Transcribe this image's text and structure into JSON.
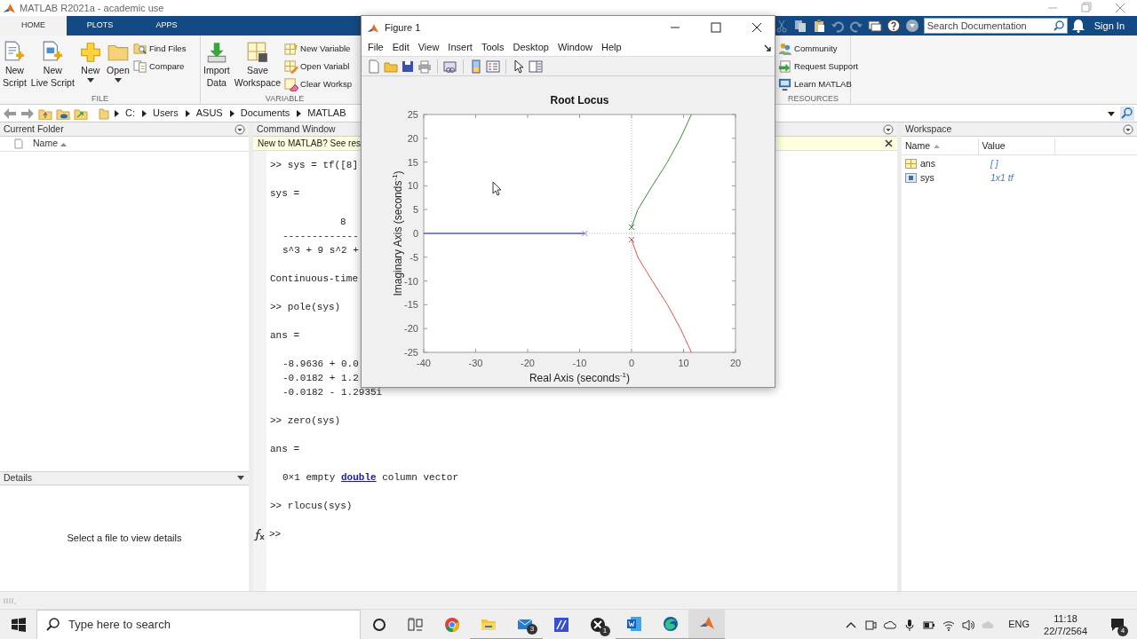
{
  "window": {
    "title": "MATLAB R2021a - academic use"
  },
  "ribbon_tabs": [
    {
      "label": "HOME",
      "selected": true
    },
    {
      "label": "PLOTS",
      "selected": false
    },
    {
      "label": "APPS",
      "selected": false
    }
  ],
  "doc_search": {
    "placeholder": "Search Documentation"
  },
  "sign_in": "Sign In",
  "toolstrip": [
    {
      "title": "FILE",
      "buttons": [
        {
          "label": "New Script",
          "kind": "large"
        },
        {
          "label": "New Live Script",
          "kind": "large"
        },
        {
          "label": "New",
          "kind": "split"
        },
        {
          "label": "Open",
          "kind": "split"
        },
        {
          "label": "Find Files",
          "kind": "small"
        },
        {
          "label": "Compare",
          "kind": "small"
        }
      ]
    },
    {
      "title": "VARIABLE",
      "buttons": [
        {
          "label": "Import Data",
          "kind": "large"
        },
        {
          "label": "Save Workspace",
          "kind": "large"
        },
        {
          "label": "New Variable",
          "kind": "small"
        },
        {
          "label": "Open Variabl",
          "kind": "small"
        },
        {
          "label": "Clear Worksp",
          "kind": "small"
        }
      ]
    },
    {
      "title": "RESOURCES",
      "buttons": [
        {
          "label": "Community",
          "kind": "small"
        },
        {
          "label": "Request Support",
          "kind": "small"
        },
        {
          "label": "Learn MATLAB",
          "kind": "small"
        }
      ]
    }
  ],
  "path": [
    "C:",
    "Users",
    "ASUS",
    "Documents",
    "MATLAB"
  ],
  "current_folder": {
    "title": "Current Folder",
    "column": "Name"
  },
  "details": {
    "title": "Details",
    "message": "Select a file to view details"
  },
  "command_window": {
    "title": "Command Window",
    "banner": "New to MATLAB? See res",
    "blocks": [
      [
        {
          "kind": "flush",
          "text": ">> sys = tf([8]"
        }
      ],
      [
        {
          "kind": "flush",
          "text": "sys ="
        }
      ],
      [
        {
          "kind": "numerator",
          "text": "8"
        },
        {
          "kind": "indent",
          "text": "-------------"
        },
        {
          "kind": "indent",
          "text": "s^3 + 9 s^2 +"
        }
      ],
      [
        {
          "kind": "flush",
          "text": "Continuous-time"
        }
      ],
      [
        {
          "kind": "flush",
          "text": ">> pole(sys)"
        }
      ],
      [
        {
          "kind": "flush",
          "text": "ans ="
        }
      ],
      [
        {
          "kind": "indent",
          "text": "-8.9636 + 0.0"
        },
        {
          "kind": "indent",
          "text": "-0.0182 + 1.2"
        },
        {
          "kind": "indent",
          "text": "-0.0182 - 1.2935i"
        }
      ],
      [
        {
          "kind": "flush",
          "text": ">> zero(sys)"
        }
      ],
      [
        {
          "kind": "flush",
          "text": "ans ="
        }
      ],
      [
        {
          "kind": "indent",
          "text": "0×1 empty ",
          "link": "double",
          "after": " column vector"
        }
      ],
      [
        {
          "kind": "flush",
          "text": ">> rlocus(sys)"
        }
      ]
    ],
    "prompt": ">>"
  },
  "workspace": {
    "title": "Workspace",
    "columns": [
      "Name",
      "Value"
    ],
    "rows": [
      {
        "name": "ans",
        "value": "[ ]",
        "kind": "matrix"
      },
      {
        "name": "sys",
        "value": "1x1 tf",
        "kind": "object"
      }
    ]
  },
  "figure": {
    "title": "Figure 1",
    "menu": [
      "File",
      "Edit",
      "View",
      "Insert",
      "Tools",
      "Desktop",
      "Window",
      "Help"
    ],
    "chart_data": {
      "type": "line",
      "title": "Root Locus",
      "xlabel": "Real Axis (seconds$^{-1}$)",
      "ylabel": "Imaginary Axis (seconds$^{-1}$)",
      "x": [
        -40,
        -9,
        0,
        1.2,
        4,
        6.9,
        9.4,
        11.5
      ],
      "series": [
        {
          "color": "#8080cc",
          "values": [
            0,
            0,
            null,
            null,
            null,
            null,
            null,
            null
          ]
        },
        {
          "color": "#3d8a3d",
          "values": [
            null,
            null,
            1.3,
            5,
            10,
            15,
            20,
            25
          ]
        },
        {
          "color": "#e0524f",
          "values": [
            null,
            null,
            -1.3,
            -5,
            -10,
            -15,
            -20,
            -25
          ]
        }
      ],
      "xlim": [
        -40,
        20
      ],
      "ylim": [
        -25,
        25
      ],
      "xticks": [
        -40,
        -30,
        -20,
        -10,
        0,
        10,
        20
      ],
      "yticks": [
        -25,
        -20,
        -15,
        -10,
        -5,
        0,
        5,
        10,
        15,
        20,
        25
      ]
    }
  },
  "taskbar": {
    "search": {
      "placeholder": "Type here to search"
    },
    "apps": [
      {
        "kind": "browser",
        "running": false,
        "selected": false
      },
      {
        "kind": "folder",
        "running": true,
        "selected": false
      },
      {
        "kind": "mail",
        "running": true,
        "selected": false,
        "badge": "3"
      },
      {
        "kind": "editor",
        "running": false,
        "selected": false
      },
      {
        "kind": "game",
        "running": false,
        "selected": false,
        "badge": "1"
      },
      {
        "kind": "document",
        "running": true,
        "selected": false
      },
      {
        "kind": "edge",
        "running": true,
        "selected": false
      },
      {
        "kind": "matlab",
        "running": true,
        "selected": true
      }
    ],
    "language": "ENG",
    "time": "11:18",
    "date": "22/7/2564",
    "notifications": "4"
  }
}
